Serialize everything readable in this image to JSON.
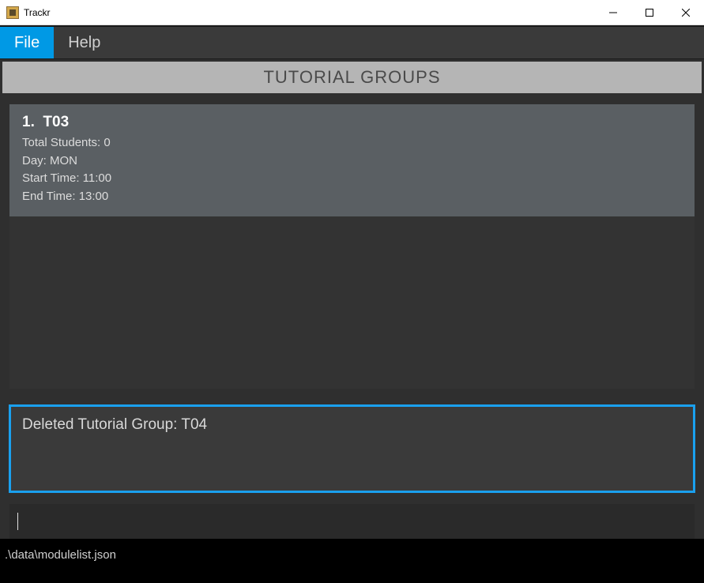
{
  "window": {
    "title": "Trackr"
  },
  "menu": {
    "file": "File",
    "help": "Help"
  },
  "section": {
    "header": "TUTORIAL GROUPS"
  },
  "groups": [
    {
      "index": "1.",
      "name": "T03",
      "total_students_label": "Total Students: 0",
      "day_label": "Day: MON",
      "start_label": "Start Time: 11:00",
      "end_label": "End Time: 13:00"
    }
  ],
  "message": {
    "text": "Deleted Tutorial Group: T04"
  },
  "command": {
    "value": ""
  },
  "status": {
    "path": ".\\data\\modulelist.json"
  }
}
